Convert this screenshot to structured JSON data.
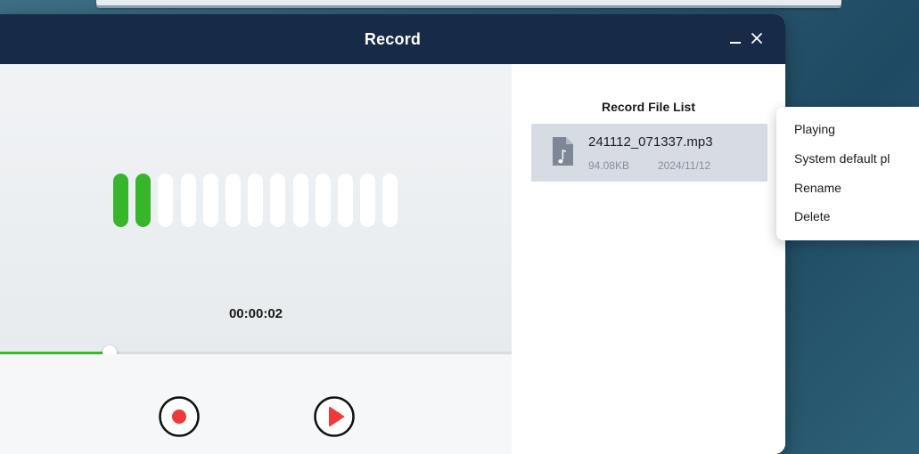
{
  "window": {
    "title": "Record"
  },
  "recorder": {
    "timer": "00:00:02",
    "level_bars_total": 13,
    "level_bars_active": 2,
    "progress_fraction": 0.2,
    "colors": {
      "active": "#37b52b",
      "record": "#f03a3a",
      "play": "#f03a3a"
    }
  },
  "controls": {
    "record_icon": "record-icon",
    "play_icon": "play-icon"
  },
  "file_list": {
    "title": "Record File List",
    "items": [
      {
        "name": "241112_071337.mp3",
        "size": "94.08KB",
        "date": "2024/11/12",
        "icon": "music-file-icon"
      }
    ]
  },
  "context_menu": {
    "items": [
      "Playing",
      "System default pl",
      "Rename",
      "Delete"
    ]
  }
}
